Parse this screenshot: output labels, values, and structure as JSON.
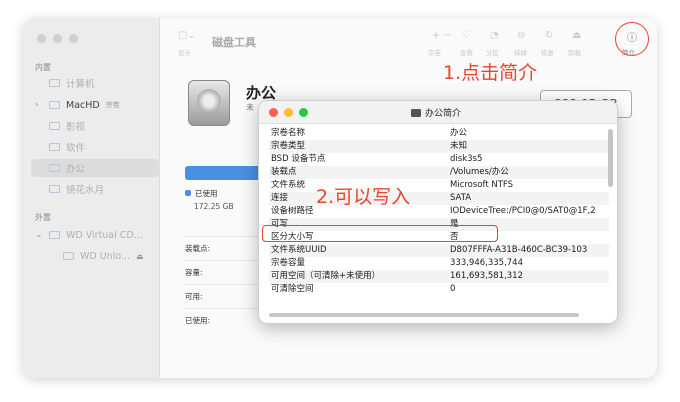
{
  "sidebar": {
    "section_internal": "内置",
    "items": [
      {
        "label": "计算机"
      },
      {
        "label": "MacHD",
        "tag": "宗卷"
      },
      {
        "label": "影视"
      },
      {
        "label": "软件"
      },
      {
        "label": "办公"
      },
      {
        "label": "镜花水月"
      }
    ],
    "section_external": "外置",
    "external_items": [
      {
        "label": "WD Virtual CD..."
      },
      {
        "label": "WD Unlo..."
      }
    ]
  },
  "toolbar": {
    "display_label": "显示",
    "title": "磁盘工具",
    "buttons": [
      "宗卷",
      "急救",
      "分区",
      "抹掉",
      "恢复",
      "卸载",
      "简介"
    ]
  },
  "volume": {
    "name": "办公",
    "subtitle": "未",
    "size": "333.95 GB",
    "used_label": "已使用",
    "used_value": "172.25 GB"
  },
  "info_rows": [
    "装载点:",
    "容量:",
    "可用:",
    "已使用:"
  ],
  "annotations": {
    "step1": "1.点击简介",
    "step2": "2.可以写入"
  },
  "popup": {
    "title": "办公简介",
    "rows": [
      {
        "key": "宗卷名称",
        "value": "办公"
      },
      {
        "key": "宗卷类型",
        "value": "未知"
      },
      {
        "key": "BSD 设备节点",
        "value": "disk3s5"
      },
      {
        "key": "装载点",
        "value": "/Volumes/办公"
      },
      {
        "key": "文件系统",
        "value": "Microsoft NTFS"
      },
      {
        "key": "连接",
        "value": "SATA"
      },
      {
        "key": "设备树路径",
        "value": "IODeviceTree:/PCI0@0/SAT0@1F,2"
      },
      {
        "key": "可写",
        "value": "是"
      },
      {
        "key": "区分大小写",
        "value": "否"
      },
      {
        "key": "文件系统UUID",
        "value": "D807FFFA-A31B-460C-BC39-103"
      },
      {
        "key": "宗卷容量",
        "value": "333,946,335,744"
      },
      {
        "key": "可用空间（可清除+未使用）",
        "value": "161,693,581,312"
      },
      {
        "key": "可清除空间",
        "value": "0"
      }
    ]
  },
  "colors": {
    "accent": "#4a90e2",
    "annotation": "#e8442b"
  }
}
